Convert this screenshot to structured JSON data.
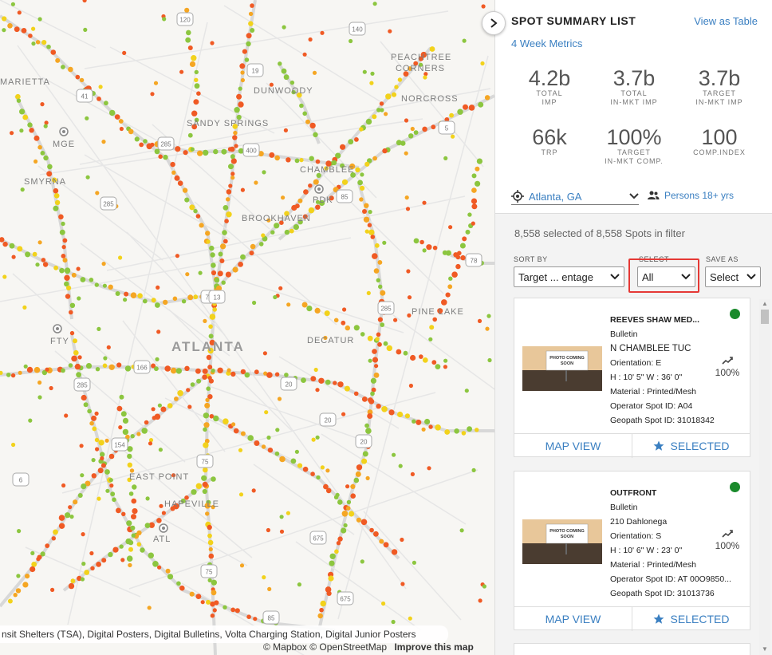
{
  "map": {
    "labels": [
      {
        "text": "MARIETTA",
        "cls": ""
      },
      {
        "text": "SMYRNA",
        "cls": ""
      },
      {
        "text": "MGE",
        "cls": ""
      },
      {
        "text": "SANDY SPRINGS",
        "cls": ""
      },
      {
        "text": "DUNWOODY",
        "cls": ""
      },
      {
        "text": "PEACHTREE",
        "cls": ""
      },
      {
        "text": "CORNERS",
        "cls": ""
      },
      {
        "text": "NORCROSS",
        "cls": ""
      },
      {
        "text": "CHAMBLEE",
        "cls": ""
      },
      {
        "text": "PDK",
        "cls": ""
      },
      {
        "text": "BROOKHAVEN",
        "cls": ""
      },
      {
        "text": "ATLANTA",
        "cls": "big"
      },
      {
        "text": "DECATUR",
        "cls": ""
      },
      {
        "text": "PINE LAKE",
        "cls": ""
      },
      {
        "text": "EAST POINT",
        "cls": ""
      },
      {
        "text": "HAPEVILLE",
        "cls": ""
      },
      {
        "text": "ATL",
        "cls": ""
      },
      {
        "text": "FTY",
        "cls": ""
      }
    ],
    "shields": [
      "120",
      "140",
      "19",
      "400",
      "285",
      "285",
      "285",
      "85",
      "78",
      "285",
      "20",
      "20",
      "20",
      "75",
      "154",
      "6",
      "166",
      "75",
      "675",
      "675",
      "75",
      "85",
      "13",
      "41",
      "5"
    ],
    "legend_text": "nsit Shelters (TSA), Digital Posters, Digital Bulletins, Volta Charging Station, Digital Junior Posters",
    "attrib_mapbox": "© Mapbox",
    "attrib_osm": "© OpenStreetMap",
    "attrib_improve": "Improve this map",
    "colors": {
      "red": "#f05a24",
      "orange": "#f5a623",
      "yellow": "#f2d21b",
      "green": "#8cc63f"
    }
  },
  "panel": {
    "title": "SPOT SUMMARY LIST",
    "view_table": "View as Table",
    "subtitle": "4 Week Metrics",
    "metrics": [
      {
        "value": "4.2b",
        "label1": "TOTAL",
        "label2": "IMP"
      },
      {
        "value": "3.7b",
        "label1": "TOTAL",
        "label2": "IN-MKT IMP"
      },
      {
        "value": "3.7b",
        "label1": "TARGET",
        "label2": "IN-MKT IMP"
      },
      {
        "value": "66k",
        "label1": "TRP",
        "label2": ""
      },
      {
        "value": "100%",
        "label1": "TARGET",
        "label2": "IN-MKT COMP."
      },
      {
        "value": "100",
        "label1": "COMP.INDEX",
        "label2": ""
      }
    ],
    "location": "Atlanta, GA",
    "audience": "Persons 18+ yrs",
    "count_text": "8,558 selected of 8,558 Spots in filter",
    "sort_label": "SORT BY",
    "sort_value": "Target ... entage",
    "select_label": "SELECT",
    "select_value": "All",
    "save_label": "SAVE AS",
    "save_value": "Select",
    "photo_text1": "PHOTO COMING",
    "photo_text2": "SOON",
    "cards": [
      {
        "name": "REEVES SHAW MED...",
        "type": "Bulletin",
        "address": "N CHAMBLEE TUC",
        "orientation": "Orientation: E",
        "size": "H : 10' 5\" W : 36' 0\"",
        "material": "Material : Printed/Mesh",
        "operator_id": "Operator Spot ID: A04",
        "geopath_id": "Geopath Spot ID: 31018342",
        "percent": "100%",
        "map_view": "MAP VIEW",
        "selected": "SELECTED"
      },
      {
        "name": "OUTFRONT",
        "type": "Bulletin",
        "address": "210 Dahlonega",
        "orientation": "Orientation: S",
        "size": "H : 10' 6\" W : 23' 0\"",
        "material": "Material : Printed/Mesh",
        "operator_id": "Operator Spot ID: AT 00O9850...",
        "geopath_id": "Geopath Spot ID: 31013736",
        "percent": "100%",
        "map_view": "MAP VIEW",
        "selected": "SELECTED"
      }
    ]
  }
}
